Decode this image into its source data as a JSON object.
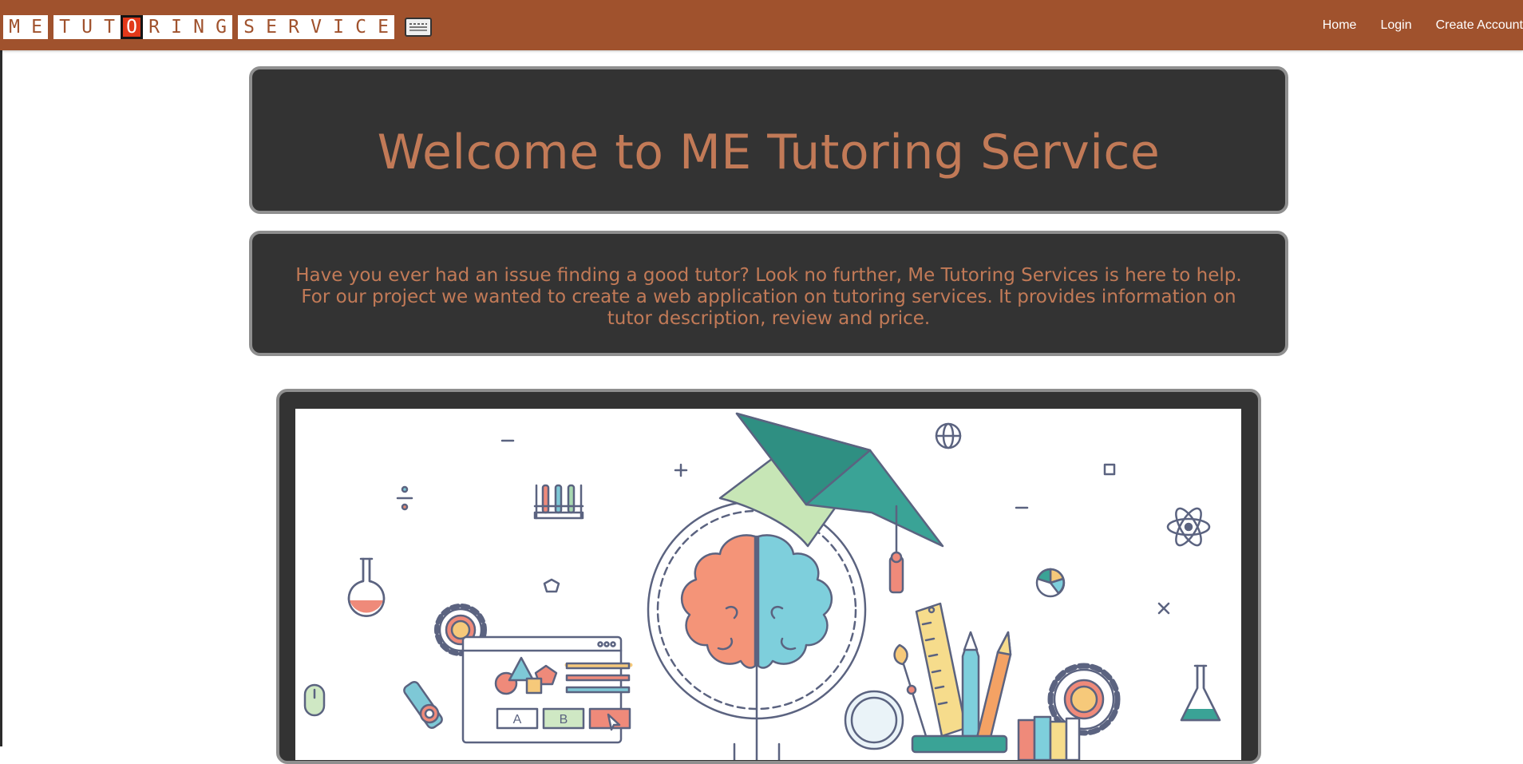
{
  "brand": {
    "words": [
      {
        "letters": [
          "M",
          "E"
        ]
      },
      {
        "letters": [
          "T",
          "U",
          "T",
          "O",
          "R",
          "I",
          "N",
          "G"
        ],
        "highlight_index": 3
      },
      {
        "letters": [
          "S",
          "E",
          "R",
          "V",
          "I",
          "C",
          "E"
        ]
      }
    ],
    "keyboard_icon": "keyboard-icon"
  },
  "nav": {
    "home": "Home",
    "login": "Login",
    "create_account": "Create Account"
  },
  "hero": {
    "title": "Welcome to ME Tutoring Service"
  },
  "about": {
    "text": "Have you ever had an issue finding a good tutor? Look no further, Me Tutoring Services is here to help. For our project we wanted to create a web application on tutoring services. It provides information on tutor description, review and price."
  },
  "illustration": {
    "tiles": [
      "A",
      "B"
    ],
    "icons": [
      "brain-icon",
      "graduation-cap-icon",
      "globe-icon",
      "atom-icon",
      "flask-icon",
      "test-tubes-icon",
      "gear-icon",
      "pie-chart-icon",
      "ruler-icon",
      "pencil-icon",
      "fountain-pen-icon",
      "paintbrush-icon",
      "magnifier-icon",
      "mouse-icon",
      "microscope-icon",
      "books-icon"
    ]
  },
  "colors": {
    "navbar": "#a0522d",
    "panel": "#333333",
    "panel_border": "#8f8f8f",
    "accent_text": "#c27a57",
    "logo_highlight": "#e2391a"
  }
}
